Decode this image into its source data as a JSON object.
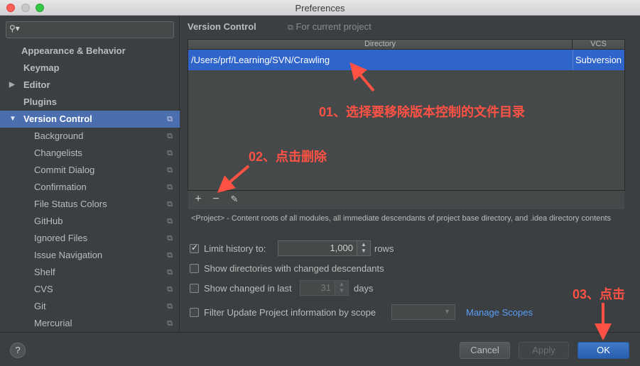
{
  "window": {
    "title": "Preferences"
  },
  "sidebar": {
    "items": [
      {
        "label": "Appearance & Behavior"
      },
      {
        "label": "Keymap"
      },
      {
        "label": "Editor"
      },
      {
        "label": "Plugins"
      },
      {
        "label": "Version Control"
      },
      {
        "label": "Background"
      },
      {
        "label": "Changelists"
      },
      {
        "label": "Commit Dialog"
      },
      {
        "label": "Confirmation"
      },
      {
        "label": "File Status Colors"
      },
      {
        "label": "GitHub"
      },
      {
        "label": "Ignored Files"
      },
      {
        "label": "Issue Navigation"
      },
      {
        "label": "Shelf"
      },
      {
        "label": "CVS"
      },
      {
        "label": "Git"
      },
      {
        "label": "Mercurial"
      }
    ]
  },
  "main": {
    "heading": "Version Control",
    "for_project": "For current project",
    "table": {
      "columns": [
        "Directory",
        "VCS"
      ],
      "rows": [
        {
          "directory": "/Users/prf/Learning/SVN/Crawling",
          "vcs": "Subversion"
        }
      ]
    },
    "toolbar": {
      "add": "+",
      "remove": "−",
      "edit": "✎"
    },
    "note": "<Project> - Content roots of all modules, all immediate descendants of project base directory, and .idea directory contents",
    "options": {
      "limit_history_label": "Limit history to:",
      "limit_history_value": "1,000",
      "rows_label": "rows",
      "show_dirs_label": "Show directories with changed descendants",
      "show_changed_label": "Show changed in last",
      "show_changed_value": "31",
      "days_label": "days",
      "filter_label": "Filter Update Project information by scope",
      "manage_scopes": "Manage Scopes"
    }
  },
  "footer": {
    "help": "?",
    "cancel": "Cancel",
    "apply": "Apply",
    "ok": "OK"
  },
  "annotations": {
    "step1": "01、选择要移除版本控制的文件目录",
    "step2": "02、点击删除",
    "step3": "03、点击"
  },
  "colors": {
    "selection": "#2f65ca",
    "sidebar_selection": "#4b6eaf",
    "annotation": "#ff5144",
    "link": "#589df6"
  }
}
